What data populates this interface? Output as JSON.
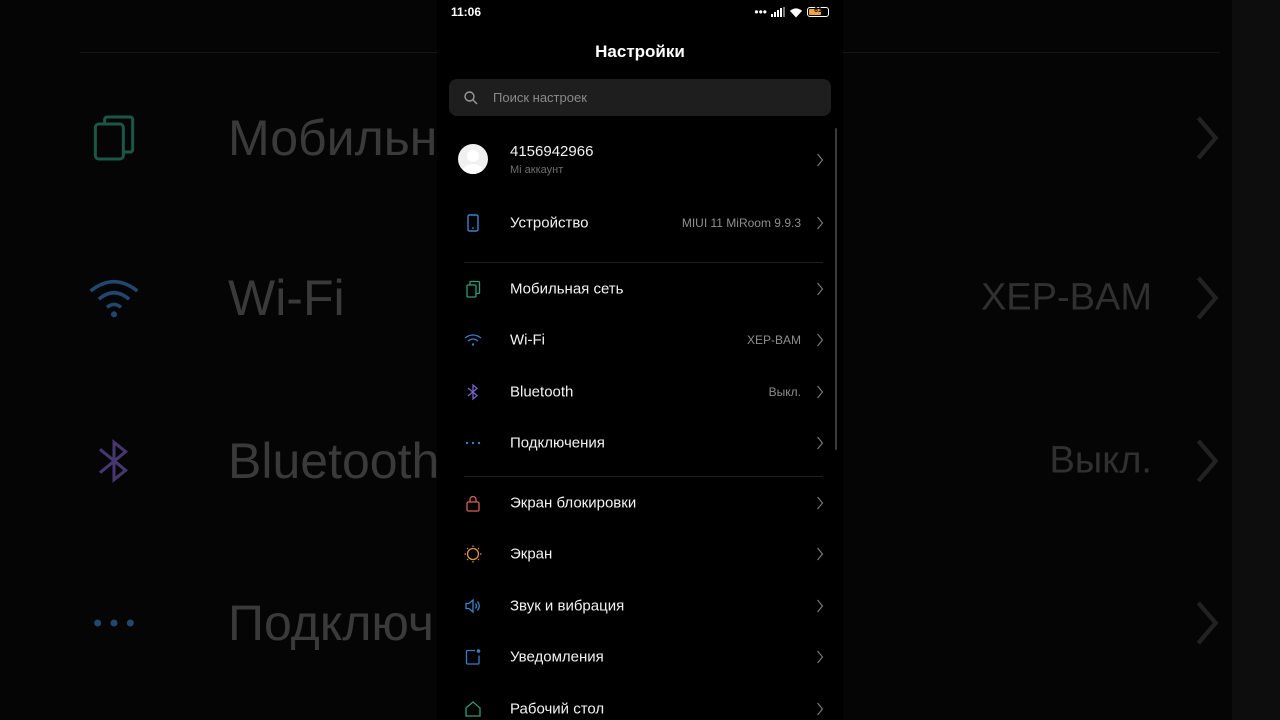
{
  "status_bar": {
    "time": "11:06",
    "battery": "61"
  },
  "page_title": "Настройки",
  "search": {
    "placeholder": "Поиск настроек"
  },
  "account": {
    "number": "4156942966",
    "subtitle": "Mi аккаунт"
  },
  "items": [
    {
      "label": "Устройство",
      "value": "MIUI 11 MiRoom 9.9.3",
      "icon": "phone-device-icon"
    },
    {
      "label": "Мобильная сеть",
      "value": "",
      "icon": "sim-cards-icon"
    },
    {
      "label": "Wi-Fi",
      "value": "XEP-BAM",
      "icon": "wifi-icon"
    },
    {
      "label": "Bluetooth",
      "value": "Выкл.",
      "icon": "bluetooth-icon"
    },
    {
      "label": "Подключения",
      "value": "",
      "icon": "dots-icon"
    },
    {
      "label": "Экран блокировки",
      "value": "",
      "icon": "lock-icon"
    },
    {
      "label": "Экран",
      "value": "",
      "icon": "brightness-icon"
    },
    {
      "label": "Звук и вибрация",
      "value": "",
      "icon": "speaker-icon"
    },
    {
      "label": "Уведомления",
      "value": "",
      "icon": "notification-icon"
    },
    {
      "label": "Рабочий стол",
      "value": "",
      "icon": "home-icon"
    }
  ],
  "background_mirror": {
    "rows": [
      {
        "label": "Мобильн",
        "value": ""
      },
      {
        "label": "Wi-Fi",
        "value": "XEP-BAM"
      },
      {
        "label": "Bluetooth",
        "value": "Выкл."
      },
      {
        "label": "Подключ",
        "value": ""
      }
    ]
  },
  "colors": {
    "mobile": "#2f9a7a",
    "wifi": "#3a7dc7",
    "bluetooth": "#7b62c9",
    "connections": "#3a7dc7",
    "lock": "#d8605a",
    "screen": "#e0934a",
    "sound": "#3a84c9",
    "notifications": "#3a7dc7",
    "home": "#2f9a7a",
    "device": "#3a84c9",
    "battery": "#f2a33a"
  }
}
